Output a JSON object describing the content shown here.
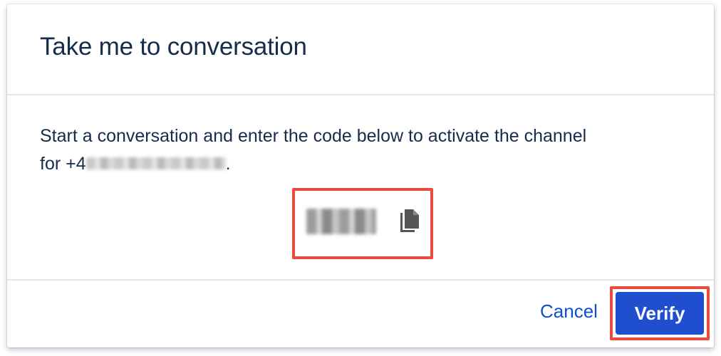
{
  "dialog": {
    "title": "Take me to conversation",
    "instruction": "Start a conversation and enter the code below to activate the channel",
    "for_prefix": "for +4",
    "for_suffix": ".",
    "code_icon": "copy-icon",
    "cancel_label": "Cancel",
    "verify_label": "Verify"
  },
  "colors": {
    "title": "#172b4d",
    "link": "#0c51cc",
    "primary": "#1f4fcf",
    "highlight": "#e94b3c"
  }
}
